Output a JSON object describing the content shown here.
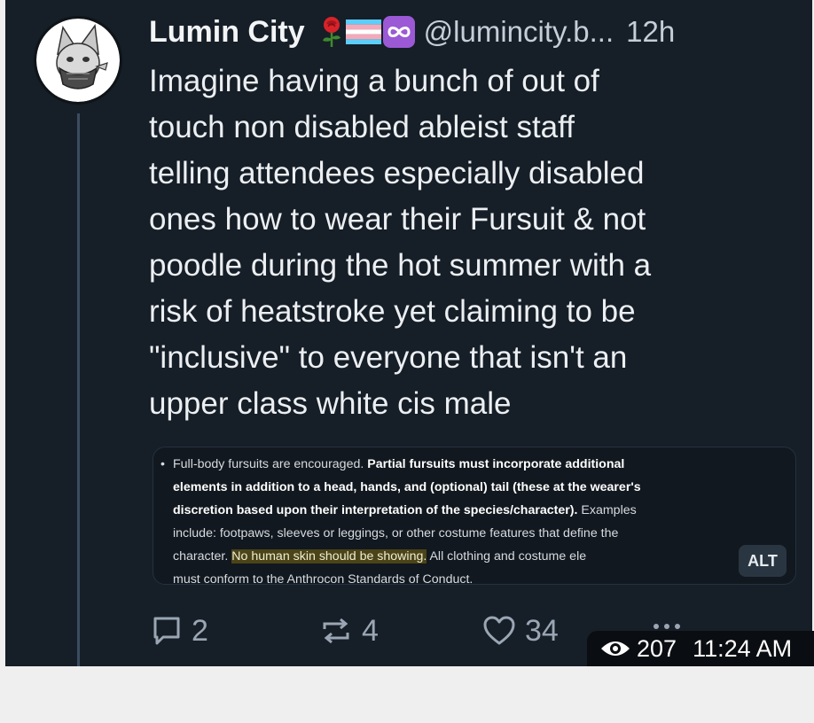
{
  "post": {
    "display_name": "Lumin City",
    "handle": "@lumincity.b...",
    "age": "12h",
    "badges": [
      "rose-emoji",
      "trans-flag-emoji",
      "infinity-emoji"
    ],
    "text_lines": [
      "Imagine having a bunch of out of",
      "touch non disabled ableist staff",
      "telling attendees especially disabled",
      "ones how to wear their Fursuit & not",
      "poodle during the hot summer with a",
      "risk of heatstroke yet claiming to be",
      "\"inclusive\" to everyone that isn't an",
      "upper class white cis male"
    ]
  },
  "embed": {
    "bullet": "•",
    "line1_normal": "Full-body fursuits are encouraged. ",
    "line1_bold": "Partial fursuits must incorporate additional",
    "line2_bold": "elements in addition to a head, hands, and (optional) tail (these at the wearer's",
    "line3_bold": "discretion based upon their interpretation of the species/character).",
    "line3_normal": " Examples",
    "line4": "include: footpaws, sleeves or leggings, or other costume features that define the",
    "line5_pre": "character. ",
    "line5_highlight": "No human skin should be showing.",
    "line5_post": " All clothing and costume ele",
    "line6": "must conform to the Anthrocon Standards of Conduct.",
    "alt_label": "ALT"
  },
  "actions": {
    "replies": "2",
    "reposts": "4",
    "likes": "34"
  },
  "meta": {
    "views": "207",
    "time": "11:24 AM"
  },
  "colors": {
    "card_bg": "#161e27",
    "page_bg": "#efefef",
    "thread_line": "#3b4c60",
    "muted": "#9aa6b4",
    "highlight": "#4a4418"
  }
}
